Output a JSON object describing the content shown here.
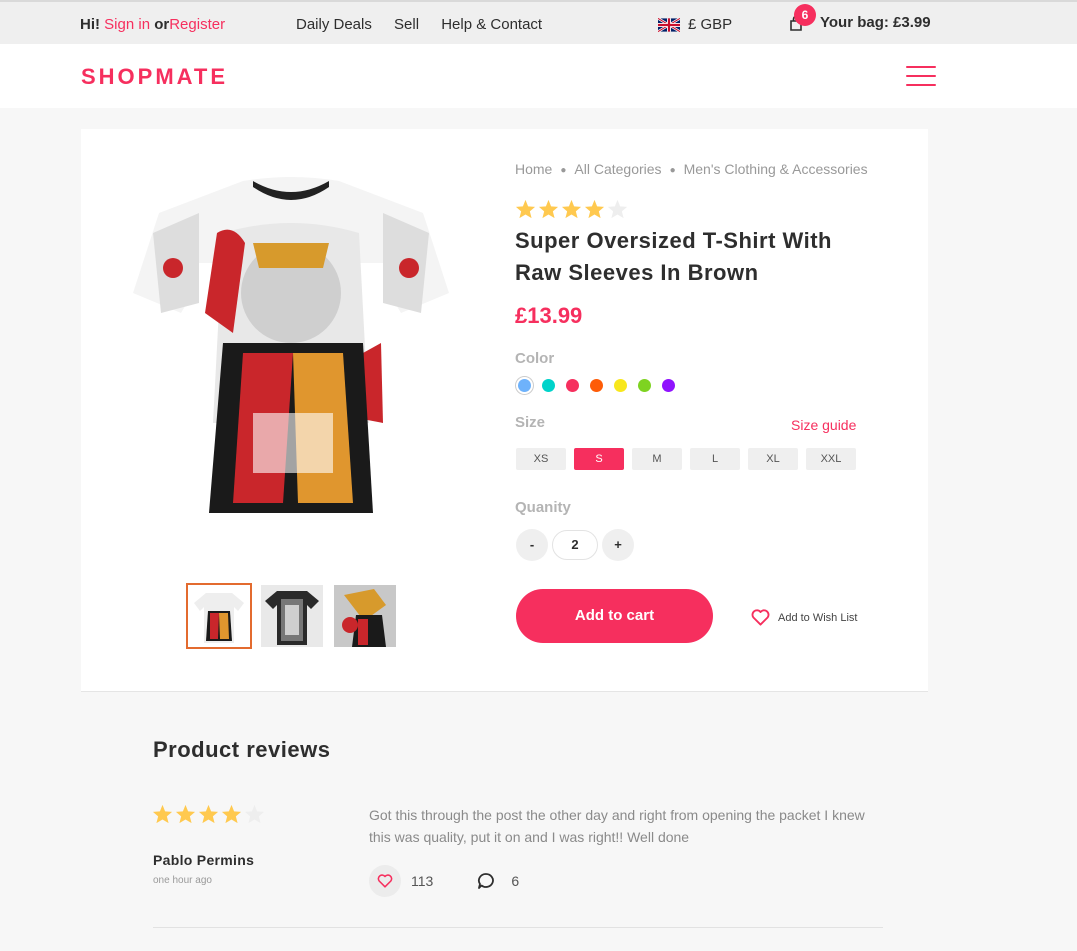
{
  "topbar": {
    "greeting": "Hi!",
    "sign_in": "Sign in",
    "or": "or",
    "register": "Register",
    "nav": [
      "Daily Deals",
      "Sell",
      "Help & Contact"
    ],
    "currency": "£ GBP",
    "bag_count": "6",
    "bag_label": "Your bag: £3.99"
  },
  "header": {
    "logo": "SHOPMATE"
  },
  "breadcrumb": [
    "Home",
    "All Categories",
    "Men's Clothing & Accessories"
  ],
  "product": {
    "rating": 4,
    "rating_max": 5,
    "title": "Super Oversized T-Shirt With Raw Sleeves In Brown",
    "price": "£13.99",
    "color_label": "Color",
    "colors": [
      "#6eb2fb",
      "#00d3ca",
      "#f62f5e",
      "#fe5c07",
      "#f8e71c",
      "#7ed321",
      "#9013fe"
    ],
    "selected_color_index": 0,
    "size_label": "Size",
    "size_guide": "Size guide",
    "sizes": [
      "XS",
      "S",
      "M",
      "L",
      "XL",
      "XXL"
    ],
    "selected_size": "S",
    "quantity_label": "Quanity",
    "quantity": "2",
    "minus": "-",
    "plus": "+",
    "add_to_cart": "Add to cart",
    "wish_list": "Add to Wish List"
  },
  "reviews": {
    "heading": "Product reviews",
    "items": [
      {
        "rating": 4,
        "author": "Pablo Permins",
        "time": "one hour ago",
        "text": "Got this through the post the other day and right from opening the packet I knew this was quality, put it on and I was right!! Well done",
        "likes": "113",
        "comments": "6"
      }
    ]
  },
  "colors": {
    "accent": "#f62f5e",
    "star": "#ffc94f",
    "star_empty": "#eeeeee"
  }
}
